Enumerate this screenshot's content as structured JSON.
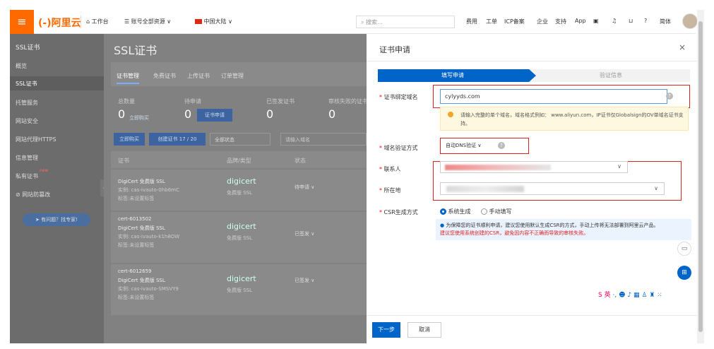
{
  "topbar": {
    "logo_text": "(-)阿里云",
    "workbench": "工作台",
    "account_resources": "账号全部资源 ∨",
    "region": "中国大陆 ∨",
    "search_placeholder": "搜索...",
    "links": [
      "费用",
      "工单",
      "ICP备案",
      "企业",
      "支持",
      "App"
    ],
    "lang": "简体"
  },
  "sidebar": {
    "title": "SSL证书",
    "items": [
      "概览",
      "SSL证书",
      "托管服务",
      "网站安全",
      "网站代理HTTPS",
      "信息管理",
      "私有证书",
      "网站防篡改"
    ],
    "new_badge": "new",
    "help_button": "有问题？找专家!"
  },
  "main": {
    "title": "SSL证书",
    "tabs": [
      "证书管理",
      "免费证书",
      "上传证书",
      "订单管理"
    ],
    "stats": [
      {
        "label": "总数量",
        "value": "0",
        "link": "立即购买"
      },
      {
        "label": "待申请",
        "value": "0",
        "link": "证书申请"
      },
      {
        "label": "已签发证书",
        "value": "0"
      },
      {
        "label": "审核失败的证书",
        "value": "0"
      }
    ],
    "toolbar": {
      "buy": "立即购买",
      "create": "创建证书 17 / 20",
      "filter": "全部状态",
      "search": "请输入域名"
    },
    "columns": [
      "证书",
      "品牌/类型",
      "状态"
    ],
    "rows": [
      {
        "id": "",
        "name": "DigiCert 免费版 SSL",
        "instance": "实例: cas-ivauto-0hb6mC",
        "tag": "标签:未设置标签",
        "brand": "digicert",
        "type": "免费版 SSL",
        "status": "待申请 ∨"
      },
      {
        "id": "cert-6013502",
        "name": "DigiCert 免费版 SSL",
        "instance": "实例: cas-ivauto-k1h8OW",
        "tag": "标签:未设置标签",
        "brand": "digicert",
        "type": "免费版 SSL",
        "status": "已签发 ∨"
      },
      {
        "id": "cert-6012659",
        "name": "DigiCert 免费版 SSL",
        "instance": "实例: cas-ivauto-SMSVY9",
        "tag": "标签:未设置标签",
        "brand": "digicert",
        "type": "免费版 SSL",
        "status": "已签发 ∨"
      }
    ]
  },
  "drawer": {
    "title": "证书申请",
    "step1": "填写申请",
    "step2": "验证信息",
    "domain_label": "证书绑定域名",
    "domain_value": "cylyyds.com",
    "domain_hint": "请输入完整的单个域名，域名格式例如： www.aliyun.com，IP证书仅Globalsign的OV单域名证书支持。",
    "verify_label": "域名验证方式",
    "verify_value": "自动DNS验证",
    "contact_label": "联系人",
    "location_label": "所在地",
    "csr_label": "CSR生成方式",
    "csr_options": [
      "系统生成",
      "手动填写"
    ],
    "csr_note": "为保障您的证书顺利申请，建议您使用默认生成CSR的方式，手动上传将无法部署到阿里云产品。",
    "csr_warning": "建议您使用系统创建的CSR，避免因内容不正确而导致的审核失败。",
    "next": "下一步",
    "cancel": "取消"
  },
  "ime": {
    "label": "英"
  }
}
